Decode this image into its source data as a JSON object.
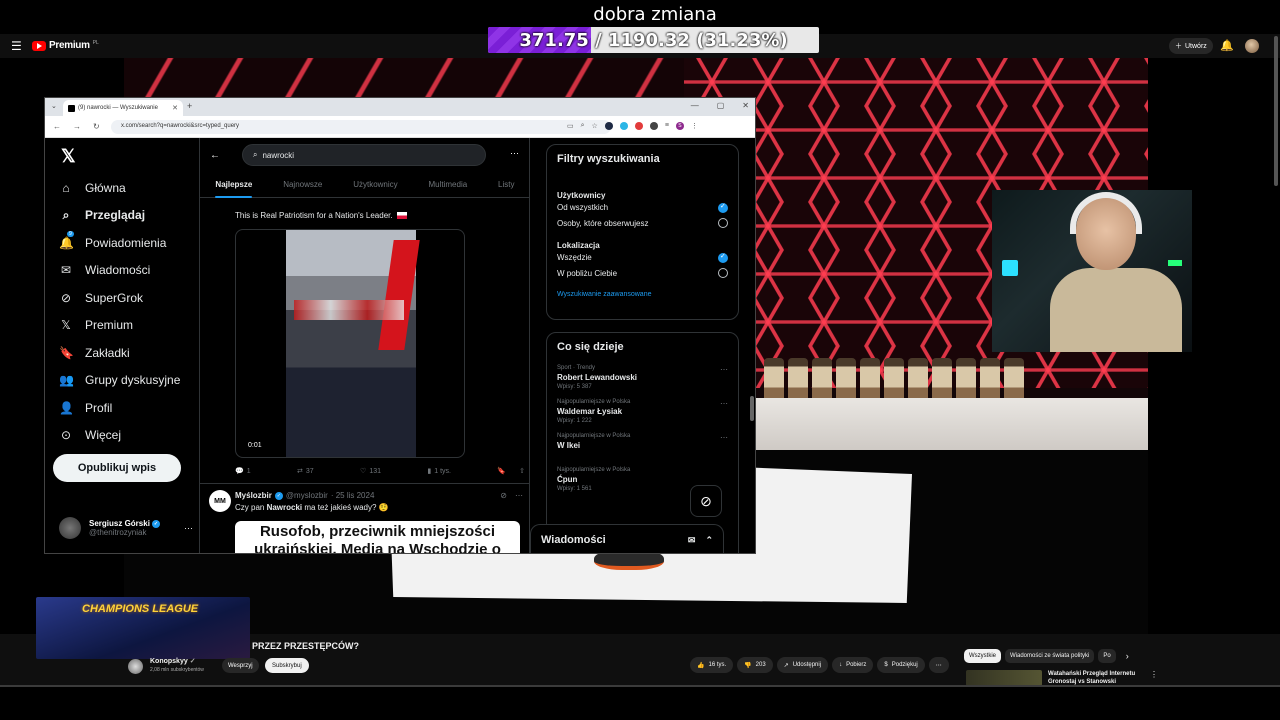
{
  "overlay": {
    "title": "dobra zmiana",
    "goal_text": "371.75 / 1190.32 (31.23%)",
    "goal_progress": 0.3123,
    "goal_color": "#8f34e6"
  },
  "youtube": {
    "logo_text": "Premium",
    "logo_superscript": "PL",
    "create_label": "Utwórz",
    "video_title": "PRZEZ PRZESTĘPCÓW?",
    "thumbnail_text": "CHAMPIONS LEAGUE",
    "channel_name": "Konopskyy",
    "channel_subs": "2,08 mln subskrybentów",
    "support_label": "Wesprzyj",
    "subscribe_label": "Subskrybuj",
    "actions": [
      {
        "icon": "thumbs-up-icon",
        "glyph": "👍",
        "label": "16 tys."
      },
      {
        "icon": "thumbs-down-icon",
        "glyph": "👎",
        "label": "203"
      },
      {
        "icon": "share-icon",
        "glyph": "↗",
        "label": "Udostępnij"
      },
      {
        "icon": "download-icon",
        "glyph": "↓",
        "label": "Pobierz"
      },
      {
        "icon": "thanks-icon",
        "glyph": "$",
        "label": "Podziękuj"
      },
      {
        "icon": "more-icon",
        "glyph": "⋯",
        "label": ""
      }
    ],
    "chips": [
      "Wszystkie",
      "Wiadomości ze świata polityki",
      "Po"
    ],
    "rec_title": "Watahański Przegląd Internetu Gronostaj vs Stanowski"
  },
  "browser": {
    "tab_title": "(9) nawrocki — Wyszukiwanie",
    "url": "x.com/search?q=nawrocki&src=typed_query",
    "ext_badge": "S"
  },
  "x": {
    "nav": [
      {
        "icon": "home-icon",
        "glyph": "⌂",
        "label": "Główna",
        "active": false
      },
      {
        "icon": "explore-icon",
        "glyph": "⌕",
        "label": "Przeglądaj",
        "active": true
      },
      {
        "icon": "notifications-icon",
        "glyph": "🔔",
        "label": "Powiadomienia",
        "active": false,
        "badge": "9"
      },
      {
        "icon": "messages-icon",
        "glyph": "✉",
        "label": "Wiadomości",
        "active": false
      },
      {
        "icon": "grok-icon",
        "glyph": "⊘",
        "label": "SuperGrok",
        "active": false
      },
      {
        "icon": "premium-icon",
        "glyph": "𝕏",
        "label": "Premium",
        "active": false
      },
      {
        "icon": "bookmarks-icon",
        "glyph": "🔖",
        "label": "Zakładki",
        "active": false
      },
      {
        "icon": "communities-icon",
        "glyph": "👥",
        "label": "Grupy dyskusyjne",
        "active": false
      },
      {
        "icon": "profile-icon",
        "glyph": "👤",
        "label": "Profil",
        "active": false
      },
      {
        "icon": "more-icon",
        "glyph": "⊙",
        "label": "Więcej",
        "active": false
      }
    ],
    "post_button": "Opublikuj wpis",
    "user": {
      "name": "Sergiusz Górski",
      "handle": "@thenitrozyniak"
    },
    "search_value": "nawrocki",
    "tabs": [
      "Najlepsze",
      "Najnowsze",
      "Użytkownicy",
      "Multimedia",
      "Listy"
    ],
    "tweet1": {
      "text": "This is Real Patriotism for a Nation's Leader.",
      "video_time": "0:01",
      "replies": "1",
      "reposts": "37",
      "likes": "131",
      "views": "1 tys."
    },
    "tweet2": {
      "avatar_text": "MM",
      "name": "Myślozbir",
      "handle": "@myslozbir",
      "date": "· 25 lis 2024",
      "text_before": "Czy pan ",
      "text_bold": "Nawrocki",
      "text_after": " ma też jakieś wady? 🤨",
      "image_text": "Rusofob, przeciwnik mniejszości ukraińskiej. Media na Wschodzie o"
    },
    "filters": {
      "title": "Filtry wyszukiwania",
      "users_heading": "Użytkownicy",
      "users_options": [
        {
          "label": "Od wszystkich",
          "selected": true
        },
        {
          "label": "Osoby, które obserwujesz",
          "selected": false
        }
      ],
      "location_heading": "Lokalizacja",
      "location_options": [
        {
          "label": "Wszędzie",
          "selected": true
        },
        {
          "label": "W pobliżu Ciebie",
          "selected": false
        }
      ],
      "advanced_link": "Wyszukiwanie zaawansowane"
    },
    "trending": {
      "title": "Co się dzieje",
      "items": [
        {
          "category": "Sport · Trendy",
          "name": "Robert Lewandowski",
          "count": "Wpisy: 5 387"
        },
        {
          "category": "Najpopularniejsze w Polska",
          "name": "Waldemar Łysiak",
          "count": "Wpisy: 1 222"
        },
        {
          "category": "Najpopularniejsze w Polska",
          "name": "W Ikei",
          "count": ""
        },
        {
          "category": "Najpopularniejsze w Polska",
          "name": "Ćpun",
          "count": "Wpisy: 1 561"
        }
      ]
    },
    "messages_drawer": "Wiadomości"
  }
}
